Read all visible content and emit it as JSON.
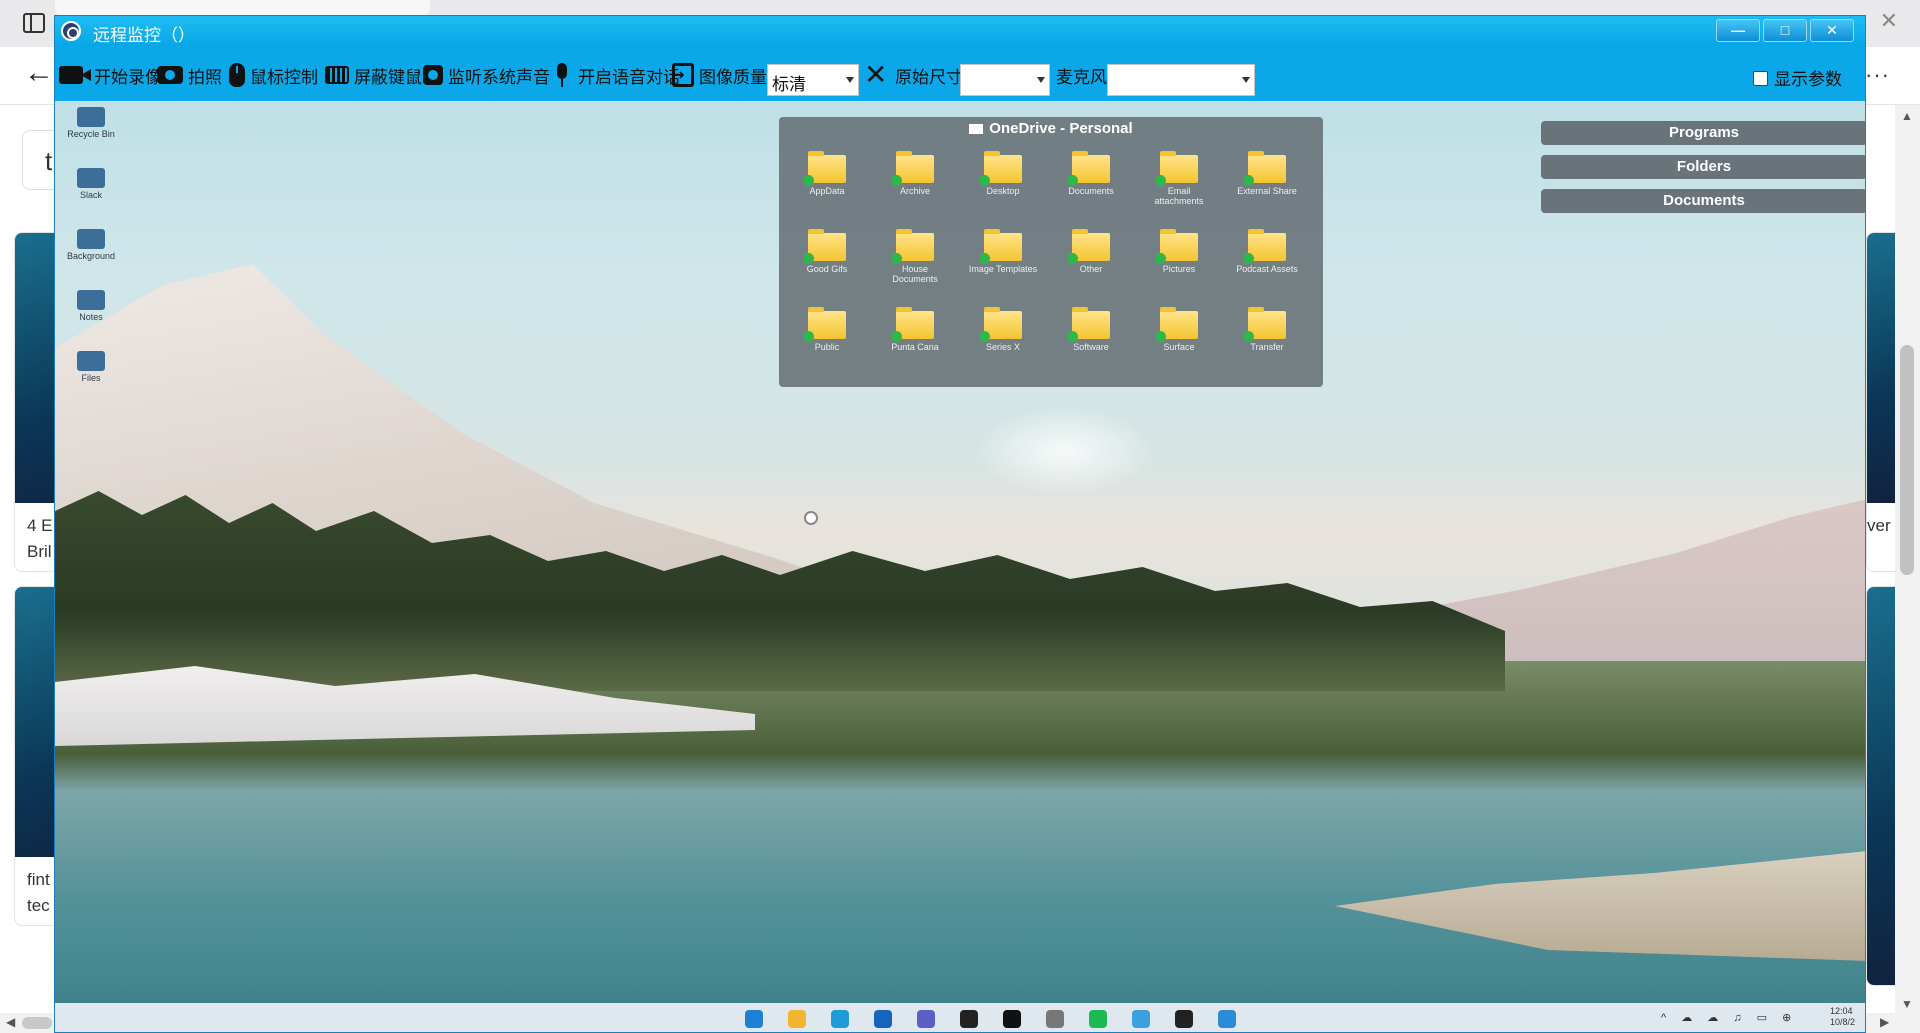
{
  "browser": {
    "close_glyph": "✕",
    "back_glyph": "←",
    "more_glyph": "···",
    "search_value": "t",
    "cards": [
      {
        "text": "4 E\nBril"
      },
      {
        "text": "fint\ntec"
      }
    ],
    "right_card_text": "ver"
  },
  "window": {
    "title": "远程监控（）",
    "min_glyph": "—",
    "max_glyph": "□",
    "close_glyph": "✕"
  },
  "toolbar": {
    "record_label": "开始录像",
    "snapshot_label": "拍照",
    "mouse_control_label": "鼠标控制",
    "block_input_label": "屏蔽键鼠",
    "listen_audio_label": "监听系统声音",
    "voice_chat_label": "开启语音对话",
    "quality_label": "图像质量",
    "quality_value": "标清",
    "original_size_label": "原始尺寸",
    "original_size_value": "",
    "microphone_label": "麦克风",
    "microphone_value": "",
    "show_params_label": "显示参数"
  },
  "remote_desktop": {
    "desktop_icons": [
      {
        "label": "Recycle Bin",
        "icon": "recycle-bin-icon"
      },
      {
        "label": "Slack",
        "icon": "app-icon"
      },
      {
        "label": "Background",
        "icon": "app-icon"
      },
      {
        "label": "Notes",
        "icon": "app-icon"
      },
      {
        "label": "Files",
        "icon": "app-icon"
      }
    ],
    "onedrive": {
      "title": "OneDrive - Personal",
      "folders": [
        "AppData",
        "Archive",
        "Desktop",
        "Documents",
        "Email attachments",
        "External Share",
        "Good Gifs",
        "House Documents",
        "Image Templates",
        "Other",
        "Pictures",
        "Podcast Assets",
        "Public",
        "Punta Cana",
        "Series X",
        "Software",
        "Surface",
        "Transfer"
      ]
    },
    "launchers": [
      "Programs",
      "Folders",
      "Documents"
    ],
    "taskbar_apps": [
      "start",
      "explorer",
      "edge",
      "outlook",
      "teams",
      "terminal",
      "notion",
      "settings",
      "spotify",
      "photos",
      "figma",
      "remote"
    ],
    "taskbar_colors": [
      "#1d7fd6",
      "#f2b531",
      "#1f9bd7",
      "#1565c0",
      "#5b5fc7",
      "#222222",
      "#111111",
      "#777777",
      "#1db954",
      "#3aa0e0",
      "#222222",
      "#2c8ad6"
    ],
    "tray_icons": "^ ☁ ☁ ♫ ▭ ⊕",
    "clock_time": "12:04",
    "clock_date": "10/8/2"
  },
  "colors": {
    "titlebar": "#07a7e6",
    "toolbar": "#0aa8e8",
    "folder": "#f4c430",
    "sync_check": "#2db84c"
  }
}
